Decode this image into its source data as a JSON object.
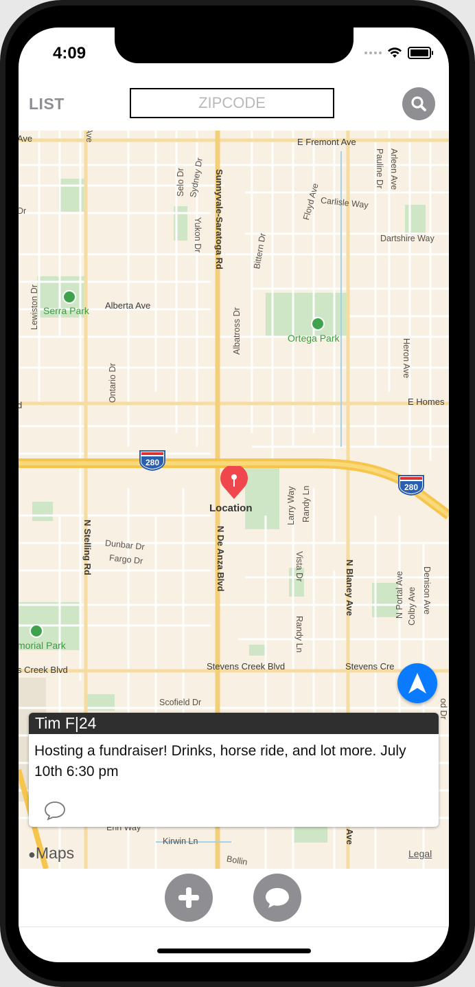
{
  "status": {
    "time": "4:09"
  },
  "topbar": {
    "list_label": "LIST",
    "zip_placeholder": "ZIPCODE"
  },
  "map": {
    "streets": {
      "e_fremont": "E Fremont Ave",
      "carlisle": "Carlisle Way",
      "dartshire": "Dartshire Way",
      "alberta": "Alberta Ave",
      "e_homestead": "E Homes",
      "stevens_creek_1": "Stevens Creek Blvd",
      "stevens_creek_2": "Stevens Cre",
      "stevens_creek_left": "s Creek Blvd",
      "sunnyvale_saratoga": "Sunnyvale-Saratoga Rd",
      "n_de_anza": "N De Anza Blvd",
      "n_stelling": "N Stelling Rd",
      "n_blaney": "N Blaney Ave",
      "selo": "Selo Dr",
      "sydney": "Sydney Dr",
      "yukon": "Yukon Dr",
      "bittern": "Bittern Dr",
      "floyd": "Floyd Ave",
      "albatross": "Albatross Dr",
      "ontario": "Ontario Dr",
      "lewiston": "Lewiston Dr",
      "arleen": "Arleen Ave",
      "pauline": "Pauline Dr",
      "heron": "Heron Ave",
      "larry": "Larry Way",
      "randy_1": "Randy Ln",
      "randy_2": "Randy Ln",
      "vista": "Vista Dr",
      "dunbar": "Dunbar Dr",
      "fargo": "Fargo Dr",
      "scofield": "Scofield Dr",
      "portal": "N Portal Ave",
      "colby": "Colby Ave",
      "denison": "Denison Ave",
      "erin": "Erin Way",
      "kirwin": "Kirwin Ln",
      "bollinger": "Bollin",
      "ave_left": "Ave",
      "dr_left": "Dr",
      "rd_left": "d",
      "ey_ave": "ey Ave",
      "od_dr": "od Dr"
    },
    "parks": {
      "serra": "Serra Park",
      "ortega": "Ortega Park",
      "memorial": "morial Park"
    },
    "highway": "280",
    "pin_label": "Location",
    "attribution": "Maps",
    "legal": "Legal"
  },
  "card": {
    "header": "Tim F|24",
    "body": "Hosting a fundraiser! Drinks, horse ride, and lot more. July 10th 6:30 pm"
  },
  "icons": {
    "search": "search-icon",
    "navigate": "location-arrow-icon",
    "add": "plus-icon",
    "chat": "chat-bubble-icon",
    "comment": "comment-icon"
  },
  "colors": {
    "pin": "#f0474f",
    "nav": "#0a7aff",
    "park": "#3fa34d",
    "highway": "#f6c54e",
    "card_header": "#2f2f2f"
  }
}
